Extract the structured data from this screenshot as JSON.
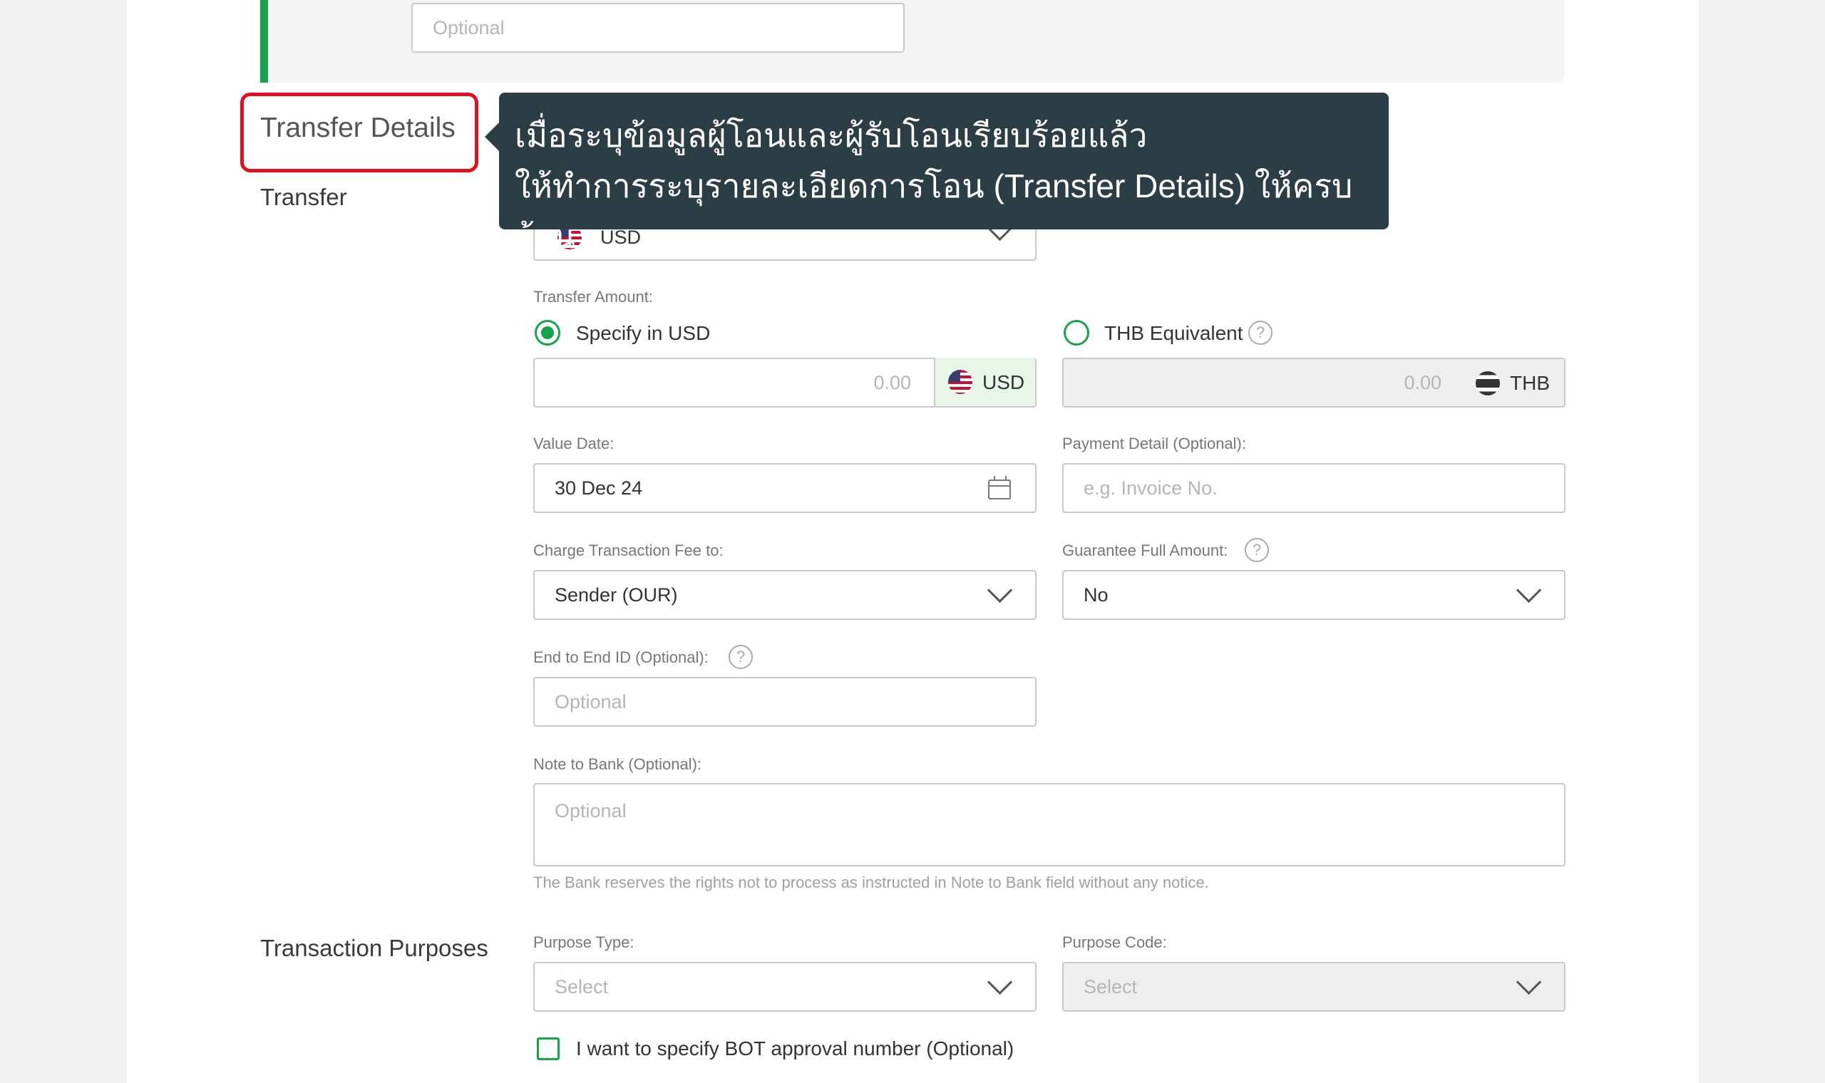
{
  "top": {
    "optional_placeholder": "Optional"
  },
  "highlight": {
    "label": "Transfer Details"
  },
  "tooltip": {
    "line1": "เมื่อระบุข้อมูลผู้โอนและผู้รับโอนเรียบร้อยแล้ว",
    "line2": "ให้ทำการระบุรายละเอียดการโอน (Transfer Details) ให้ครบถ้วน"
  },
  "sections": {
    "transfer": "Transfer",
    "purposes": "Transaction Purposes"
  },
  "currency": {
    "selected": "USD",
    "flag_icon": "us-flag-icon"
  },
  "amount": {
    "label": "Transfer Amount:",
    "option_usd": "Specify in USD",
    "option_thb": "THB Equivalent",
    "usd_placeholder": "0.00",
    "usd_unit": "USD",
    "thb_placeholder": "0.00",
    "thb_unit": "THB",
    "selected_option": "Specify in USD"
  },
  "value_date": {
    "label": "Value Date:",
    "value": "30 Dec 24"
  },
  "payment_detail": {
    "label": "Payment Detail (Optional):",
    "placeholder": "e.g. Invoice No."
  },
  "charge_fee": {
    "label": "Charge Transaction Fee to:",
    "value": "Sender (OUR)"
  },
  "guarantee": {
    "label": "Guarantee Full Amount:",
    "value": "No"
  },
  "end_to_end": {
    "label": "End to End ID (Optional):",
    "placeholder": "Optional"
  },
  "note_to_bank": {
    "label": "Note to Bank (Optional):",
    "placeholder": "Optional",
    "disclaimer": "The Bank reserves the rights not to process as instructed in Note to Bank field without any notice."
  },
  "purpose_type": {
    "label": "Purpose Type:",
    "placeholder": "Select"
  },
  "purpose_code": {
    "label": "Purpose Code:",
    "placeholder": "Select"
  },
  "bot_checkbox": {
    "label": "I want to specify BOT approval number (Optional)",
    "checked": false
  },
  "help_icon": "?",
  "colors": {
    "accent": "#16a34a",
    "highlight": "#e0101e",
    "tooltip_bg": "#2b3e45"
  }
}
